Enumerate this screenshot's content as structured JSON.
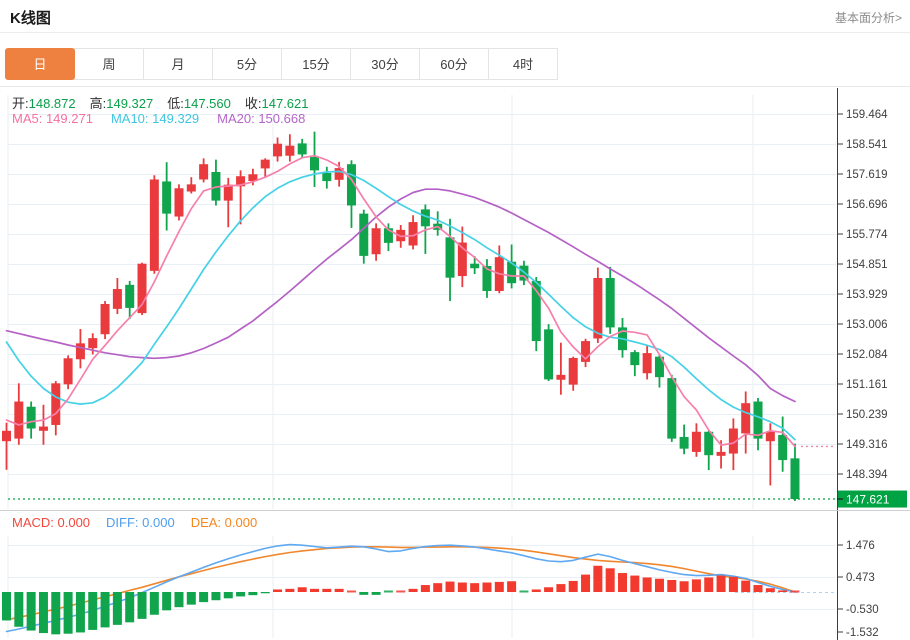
{
  "header": {
    "title": "K线图",
    "link": "基本面分析>"
  },
  "tabs": [
    {
      "id": "day",
      "label": "日",
      "active": true
    },
    {
      "id": "week",
      "label": "周",
      "active": false
    },
    {
      "id": "month",
      "label": "月",
      "active": false
    },
    {
      "id": "m5",
      "label": "5分",
      "active": false
    },
    {
      "id": "m15",
      "label": "15分",
      "active": false
    },
    {
      "id": "m30",
      "label": "30分",
      "active": false
    },
    {
      "id": "m60",
      "label": "60分",
      "active": false
    },
    {
      "id": "h4",
      "label": "4时",
      "active": false
    }
  ],
  "ohlc": {
    "items": [
      {
        "id": "open",
        "label": "开:",
        "value": "148.872"
      },
      {
        "id": "high",
        "label": "高:",
        "value": "149.327"
      },
      {
        "id": "low",
        "label": "低:",
        "value": "147.560"
      },
      {
        "id": "close",
        "label": "收:",
        "value": "147.621"
      }
    ]
  },
  "ma_legend": [
    {
      "id": "ma5",
      "name": "MA5:",
      "value": "149.271",
      "color": "#f5719f"
    },
    {
      "id": "ma10",
      "name": "MA10:",
      "value": "149.329",
      "color": "#3ec6e0"
    },
    {
      "id": "ma20",
      "name": "MA20:",
      "value": "150.668",
      "color": "#b565c8"
    }
  ],
  "macd_legend": [
    {
      "id": "macd",
      "name": "MACD:",
      "value": "0.000",
      "color": "#f0483e"
    },
    {
      "id": "diff",
      "name": "DIFF:",
      "value": "0.000",
      "color": "#4f9ef0"
    },
    {
      "id": "dea",
      "name": "DEA:",
      "value": "0.000",
      "color": "#f5871f"
    }
  ],
  "chart_data": {
    "type": "candlestick+macd",
    "title": "K线图 日线",
    "legend_position": "top-left",
    "grid": true,
    "price_axis": {
      "side": "right",
      "ticks": [
        "159.464",
        "158.541",
        "157.619",
        "156.696",
        "155.774",
        "154.851",
        "153.929",
        "153.006",
        "152.084",
        "151.161",
        "150.239",
        "149.316",
        "148.394"
      ],
      "last_price": "147.621",
      "last_price_color": "#00a344"
    },
    "macd_axis": {
      "side": "right",
      "ticks": [
        "1.476",
        "0.473",
        "-0.530",
        "-1.532"
      ]
    },
    "candles_ohlc": [
      [
        149.4,
        149.97,
        148.52,
        149.72
      ],
      [
        149.48,
        151.18,
        149.29,
        150.62
      ],
      [
        150.46,
        150.62,
        149.48,
        149.79
      ],
      [
        149.72,
        150.52,
        149.29,
        149.85
      ],
      [
        149.9,
        151.25,
        149.58,
        151.18
      ],
      [
        151.15,
        152.04,
        151.0,
        151.95
      ],
      [
        151.92,
        152.85,
        151.64,
        152.41
      ],
      [
        152.26,
        152.72,
        152.07,
        152.57
      ],
      [
        152.69,
        153.71,
        152.54,
        153.62
      ],
      [
        153.47,
        154.42,
        153.31,
        154.08
      ],
      [
        154.21,
        154.33,
        153.16,
        153.5
      ],
      [
        153.34,
        154.89,
        153.28,
        154.86
      ],
      [
        154.64,
        157.58,
        154.55,
        157.45
      ],
      [
        157.39,
        157.98,
        155.88,
        156.4
      ],
      [
        156.31,
        157.3,
        156.19,
        157.18
      ],
      [
        157.08,
        157.52,
        157.02,
        157.3
      ],
      [
        157.45,
        158.1,
        157.36,
        157.92
      ],
      [
        157.68,
        158.06,
        156.65,
        156.8
      ],
      [
        156.8,
        157.5,
        155.98,
        157.29
      ],
      [
        157.24,
        157.73,
        156.07,
        157.55
      ],
      [
        157.4,
        157.78,
        157.27,
        157.61
      ],
      [
        157.79,
        158.1,
        157.5,
        158.06
      ],
      [
        158.16,
        158.74,
        158.0,
        158.55
      ],
      [
        158.18,
        158.84,
        158.0,
        158.49
      ],
      [
        158.56,
        158.7,
        158.1,
        158.22
      ],
      [
        158.14,
        158.92,
        157.22,
        157.73
      ],
      [
        157.65,
        157.84,
        157.17,
        157.4
      ],
      [
        157.44,
        157.99,
        157.23,
        157.8
      ],
      [
        157.92,
        158.04,
        155.96,
        156.65
      ],
      [
        156.4,
        156.52,
        154.86,
        155.1
      ],
      [
        155.15,
        156.1,
        154.95,
        155.95
      ],
      [
        155.95,
        156.1,
        155.25,
        155.5
      ],
      [
        155.55,
        156.05,
        155.35,
        155.9
      ],
      [
        155.42,
        156.35,
        155.3,
        156.14
      ],
      [
        156.53,
        156.68,
        155.16,
        156.01
      ],
      [
        156.09,
        156.47,
        155.72,
        155.9
      ],
      [
        155.67,
        156.24,
        153.71,
        154.43
      ],
      [
        154.48,
        156.0,
        154.14,
        155.51
      ],
      [
        154.86,
        155.09,
        154.54,
        154.72
      ],
      [
        154.79,
        155.0,
        153.81,
        154.02
      ],
      [
        154.02,
        155.42,
        153.95,
        155.06
      ],
      [
        154.92,
        155.45,
        154.1,
        154.26
      ],
      [
        154.8,
        154.95,
        154.2,
        154.34
      ],
      [
        154.33,
        154.45,
        152.17,
        152.48
      ],
      [
        152.84,
        153.0,
        151.25,
        151.3
      ],
      [
        151.29,
        152.43,
        150.83,
        151.44
      ],
      [
        151.14,
        152.0,
        150.95,
        151.96
      ],
      [
        151.84,
        152.55,
        151.68,
        152.48
      ],
      [
        152.56,
        154.74,
        152.42,
        154.42
      ],
      [
        154.42,
        154.76,
        152.7,
        152.9
      ],
      [
        152.9,
        153.19,
        151.97,
        152.2
      ],
      [
        152.14,
        152.2,
        151.4,
        151.74
      ],
      [
        151.49,
        152.36,
        151.3,
        152.11
      ],
      [
        152.0,
        152.05,
        151.05,
        151.37
      ],
      [
        151.34,
        151.44,
        149.38,
        149.48
      ],
      [
        149.53,
        149.91,
        149.0,
        149.17
      ],
      [
        149.07,
        149.95,
        148.92,
        149.69
      ],
      [
        149.69,
        149.72,
        148.51,
        148.97
      ],
      [
        148.95,
        149.43,
        148.56,
        149.07
      ],
      [
        149.02,
        150.1,
        148.51,
        149.79
      ],
      [
        149.64,
        150.93,
        149.02,
        150.57
      ],
      [
        150.62,
        150.73,
        149.12,
        149.48
      ],
      [
        149.4,
        149.95,
        148.04,
        149.69
      ],
      [
        149.59,
        150.16,
        148.46,
        148.82
      ],
      [
        148.872,
        149.327,
        147.56,
        147.621
      ]
    ],
    "ma5": [
      150.05,
      149.9,
      150.0,
      150.05,
      150.25,
      150.7,
      151.3,
      151.92,
      152.35,
      152.8,
      153.2,
      153.6,
      154.3,
      155.1,
      155.85,
      156.55,
      157.1,
      157.22,
      157.25,
      157.28,
      157.38,
      157.52,
      157.7,
      157.93,
      158.12,
      158.18,
      158.05,
      157.85,
      157.45,
      156.85,
      156.3,
      155.9,
      155.7,
      155.72,
      155.9,
      156.0,
      155.7,
      155.35,
      155.05,
      154.7,
      154.55,
      154.48,
      154.48,
      154.03,
      153.49,
      152.76,
      152.3,
      151.93,
      152.31,
      152.62,
      152.79,
      152.75,
      152.67,
      152.06,
      151.38,
      150.77,
      150.36,
      149.74,
      149.28,
      149.34,
      149.62,
      149.58,
      149.72,
      149.67,
      149.24
    ],
    "ma10": [
      152.45,
      151.88,
      151.4,
      151.02,
      150.76,
      150.6,
      150.54,
      150.58,
      150.76,
      151.05,
      151.42,
      151.82,
      152.38,
      152.92,
      153.48,
      154.08,
      154.68,
      155.22,
      155.72,
      156.18,
      156.58,
      156.92,
      157.18,
      157.38,
      157.52,
      157.62,
      157.68,
      157.7,
      157.6,
      157.42,
      157.18,
      156.92,
      156.68,
      156.48,
      156.32,
      156.2,
      156.02,
      155.82,
      155.6,
      155.35,
      155.12,
      154.88,
      154.6,
      154.28,
      153.92,
      153.55,
      153.2,
      152.92,
      152.72,
      152.6,
      152.55,
      152.45,
      152.35,
      152.22,
      152.0,
      151.68,
      151.32,
      150.98,
      150.68,
      150.45,
      150.28,
      150.15,
      150.0,
      149.8,
      149.45
    ],
    "ma20": [
      152.8,
      152.71,
      152.62,
      152.53,
      152.45,
      152.36,
      152.28,
      152.2,
      152.12,
      152.06,
      152.0,
      151.97,
      151.95,
      151.97,
      152.02,
      152.12,
      152.25,
      152.42,
      152.6,
      152.85,
      153.1,
      153.4,
      153.7,
      154.02,
      154.35,
      154.68,
      155.0,
      155.3,
      155.6,
      155.95,
      156.3,
      156.6,
      156.85,
      157.05,
      157.15,
      157.15,
      157.1,
      157.0,
      156.9,
      156.75,
      156.6,
      156.42,
      156.22,
      156.02,
      155.82,
      155.6,
      155.38,
      155.15,
      154.93,
      154.7,
      154.48,
      154.25,
      154.0,
      153.75,
      153.48,
      153.18,
      152.88,
      152.58,
      152.3,
      152.02,
      151.75,
      151.42,
      151.02,
      150.8,
      150.62
    ],
    "macd_hist": [
      -0.9,
      -1.1,
      -1.22,
      -1.3,
      -1.34,
      -1.32,
      -1.28,
      -1.2,
      -1.12,
      -1.04,
      -0.96,
      -0.85,
      -0.72,
      -0.58,
      -0.48,
      -0.4,
      -0.32,
      -0.26,
      -0.2,
      -0.14,
      -0.1,
      -0.04,
      0.08,
      0.1,
      0.15,
      0.1,
      0.1,
      0.1,
      0.02,
      -0.09,
      -0.09,
      -0.01,
      0.02,
      0.1,
      0.22,
      0.28,
      0.33,
      0.3,
      0.28,
      0.3,
      0.32,
      0.34,
      -0.03,
      0.08,
      0.15,
      0.25,
      0.35,
      0.55,
      0.83,
      0.75,
      0.6,
      0.52,
      0.46,
      0.42,
      0.38,
      0.34,
      0.4,
      0.46,
      0.52,
      0.48,
      0.36,
      0.22,
      0.12,
      0.05,
      0.02
    ],
    "diff_line": [
      -1.25,
      -1.17,
      -1.08,
      -0.99,
      -0.9,
      -0.8,
      -0.7,
      -0.58,
      -0.45,
      -0.32,
      -0.18,
      -0.02,
      0.15,
      0.32,
      0.48,
      0.63,
      0.78,
      0.92,
      1.05,
      1.17,
      1.28,
      1.38,
      1.46,
      1.5,
      1.48,
      1.44,
      1.4,
      1.42,
      1.45,
      1.43,
      1.36,
      1.28,
      1.3,
      1.38,
      1.44,
      1.47,
      1.48,
      1.46,
      1.42,
      1.36,
      1.3,
      1.24,
      1.15,
      1.05,
      0.98,
      0.96,
      1.0,
      1.1,
      1.2,
      1.12,
      1.0,
      0.9,
      0.8,
      0.7,
      0.62,
      0.55,
      0.52,
      0.53,
      0.55,
      0.5,
      0.43,
      0.3,
      0.18,
      0.08,
      0.0
    ],
    "dea_line": [
      -0.88,
      -0.8,
      -0.72,
      -0.63,
      -0.54,
      -0.45,
      -0.35,
      -0.25,
      -0.15,
      -0.05,
      0.05,
      0.15,
      0.26,
      0.37,
      0.48,
      0.58,
      0.68,
      0.78,
      0.87,
      0.96,
      1.04,
      1.12,
      1.19,
      1.25,
      1.3,
      1.34,
      1.38,
      1.4,
      1.42,
      1.43,
      1.43,
      1.42,
      1.41,
      1.41,
      1.42,
      1.42,
      1.43,
      1.43,
      1.42,
      1.41,
      1.39,
      1.36,
      1.32,
      1.27,
      1.21,
      1.15,
      1.09,
      1.04,
      1.0,
      0.97,
      0.95,
      0.93,
      0.9,
      0.86,
      0.81,
      0.74,
      0.66,
      0.58,
      0.51,
      0.46,
      0.41,
      0.34,
      0.25,
      0.13,
      0.0
    ],
    "colors": {
      "up": "#e93b3d",
      "down": "#10a44c",
      "ma5": "#f77fab",
      "ma10": "#45d1e6",
      "ma20": "#b562c5",
      "macd_up": "#f23a2e",
      "macd_down": "#10a44c",
      "diff": "#5fa8f2",
      "dea": "#f0872e",
      "grid": "#e9eff6",
      "axis": "#3c3c3c",
      "label": "#3f3f3f",
      "last_price": "#00a344"
    }
  }
}
